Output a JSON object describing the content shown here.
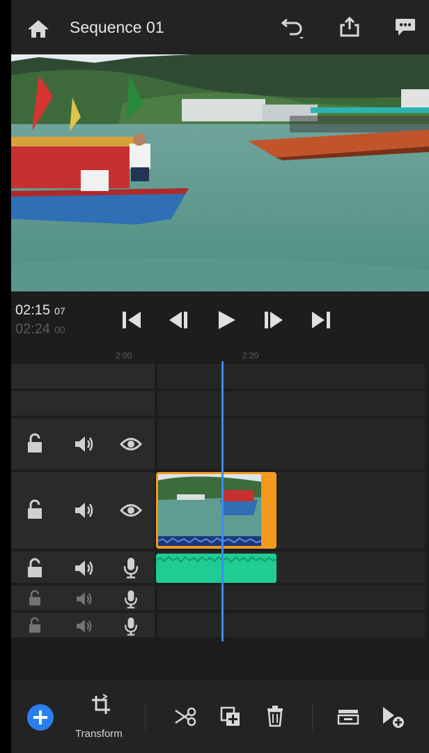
{
  "header": {
    "title": "Sequence 01"
  },
  "transport": {
    "current_time": "02:15",
    "current_frames": "07",
    "total_time": "02:24",
    "total_frames": "00"
  },
  "ruler": {
    "tick_1": "2:00",
    "tick_2": "2:20"
  },
  "toolbar": {
    "transform_label": "Transform"
  },
  "colors": {
    "accent": "#3b8cf0",
    "clip_border": "#f39a1e",
    "audio_clip": "#1fcc93",
    "background": "#1d1d1d"
  }
}
